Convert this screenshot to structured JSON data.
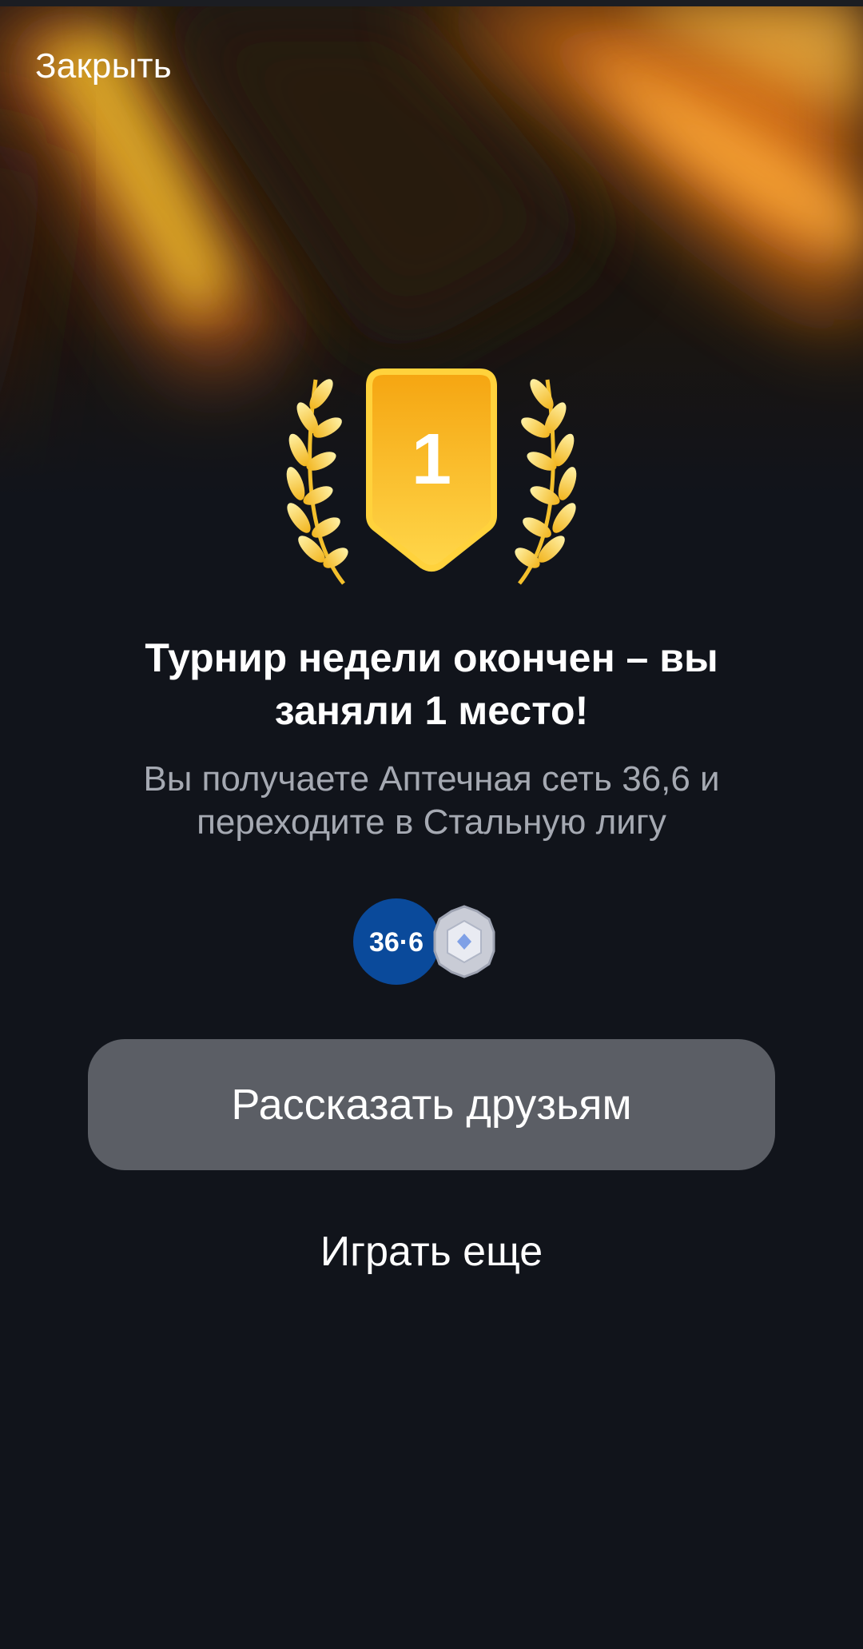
{
  "header": {
    "close_label": "Закрыть"
  },
  "badge": {
    "place_number": "1",
    "icon": "laurel-shield-icon"
  },
  "result": {
    "title": "Турнир недели окончен – вы заняли 1 место!",
    "subtitle": "Вы получаете Аптечная сеть 36,6 и переходите в Стальную лигу"
  },
  "rewards": {
    "partner_logo_text": "36·6",
    "partner_logo_color": "#0a4a9b",
    "league_icon": "steel-league-badge-icon"
  },
  "actions": {
    "share_label": "Рассказать друзьям",
    "play_again_label": "Играть еще"
  },
  "colors": {
    "background": "#11141b",
    "button_bg": "#5b5e65",
    "gold": "#f7b51c",
    "subtitle_text": "#a5a9b2"
  }
}
